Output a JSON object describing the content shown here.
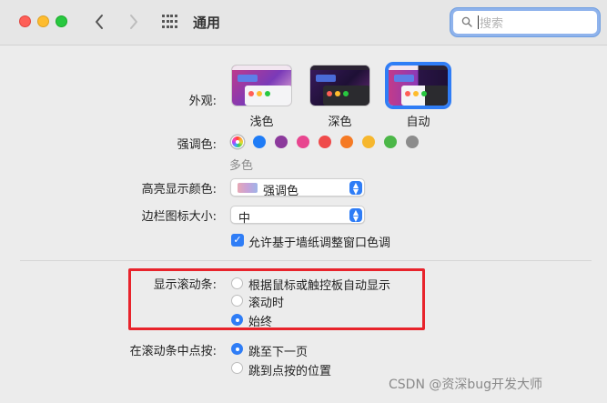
{
  "window": {
    "title": "通用",
    "search_placeholder": "搜索"
  },
  "appearance": {
    "label": "外观:",
    "options": [
      {
        "label": "浅色",
        "selected": false
      },
      {
        "label": "深色",
        "selected": false
      },
      {
        "label": "自动",
        "selected": true
      }
    ]
  },
  "accent": {
    "label": "强调色:",
    "selected_caption": "多色",
    "colors": [
      "multicolor",
      "#1f7cf6",
      "#8c3a9c",
      "#e8468f",
      "#ef4a4a",
      "#f57a24",
      "#f6b72e",
      "#4cb748",
      "#8c8c8c"
    ]
  },
  "highlight": {
    "label": "高亮显示颜色:",
    "value": "强调色"
  },
  "sidebar_icon_size": {
    "label": "边栏图标大小:",
    "value": "中"
  },
  "wallpaper_tint": {
    "label": "允许基于墙纸调整窗口色调",
    "checked": true
  },
  "show_scrollbars": {
    "label": "显示滚动条:",
    "options": [
      {
        "label": "根据鼠标或触控板自动显示",
        "selected": false
      },
      {
        "label": "滚动时",
        "selected": false
      },
      {
        "label": "始终",
        "selected": true
      }
    ]
  },
  "click_scrollbar": {
    "label": "在滚动条中点按:",
    "options": [
      {
        "label": "跳至下一页",
        "selected": true
      },
      {
        "label": "跳到点按的位置",
        "selected": false
      }
    ]
  },
  "watermark": "CSDN @资深bug开发大师",
  "colors": {
    "accent_blue": "#2f7df6",
    "highlight_box": "#e8232b"
  }
}
